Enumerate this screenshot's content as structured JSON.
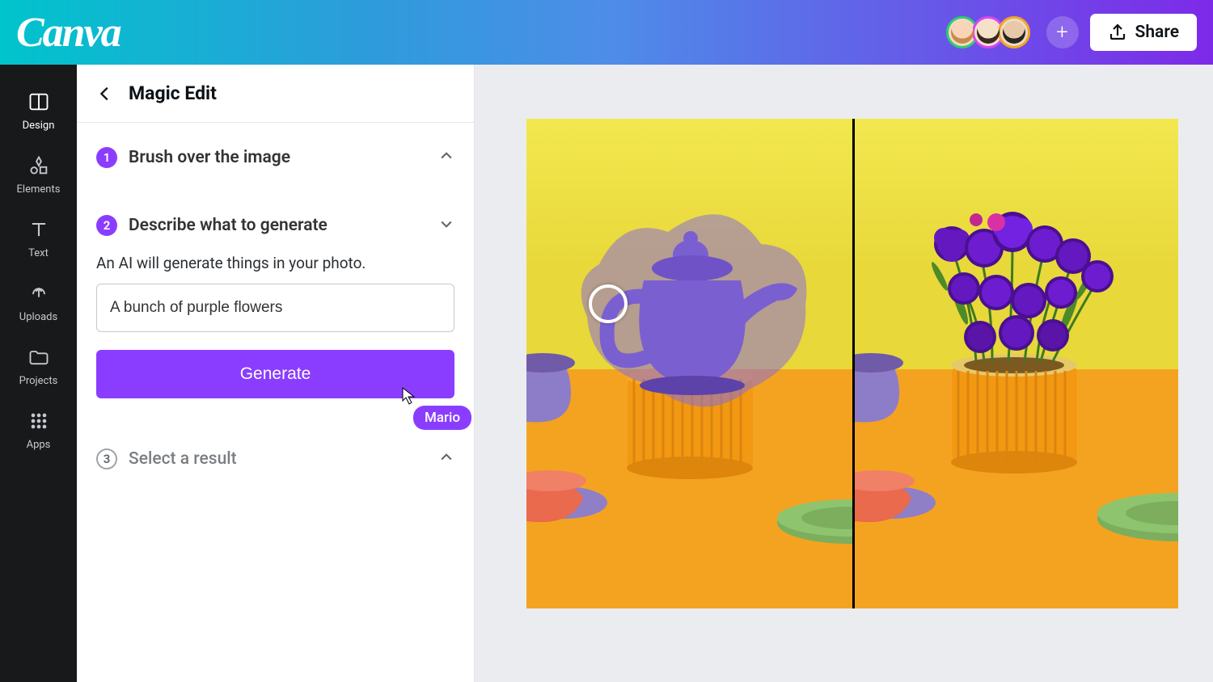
{
  "header": {
    "logo": "Canva",
    "share_label": "Share",
    "collaborator_badge": "Mario"
  },
  "sidebar": {
    "items": [
      {
        "label": "Design",
        "icon": "design-icon"
      },
      {
        "label": "Elements",
        "icon": "elements-icon"
      },
      {
        "label": "Text",
        "icon": "text-icon"
      },
      {
        "label": "Uploads",
        "icon": "uploads-icon"
      },
      {
        "label": "Projects",
        "icon": "projects-icon"
      },
      {
        "label": "Apps",
        "icon": "apps-icon"
      }
    ]
  },
  "panel": {
    "title": "Magic Edit",
    "steps": {
      "step1": {
        "num": "1",
        "label": "Brush over the image"
      },
      "step2": {
        "num": "2",
        "label": "Describe what to generate",
        "description": "An AI will generate things in your photo.",
        "input_value": "A bunch of purple flowers",
        "button_label": "Generate"
      },
      "step3": {
        "num": "3",
        "label": "Select a result"
      }
    }
  }
}
